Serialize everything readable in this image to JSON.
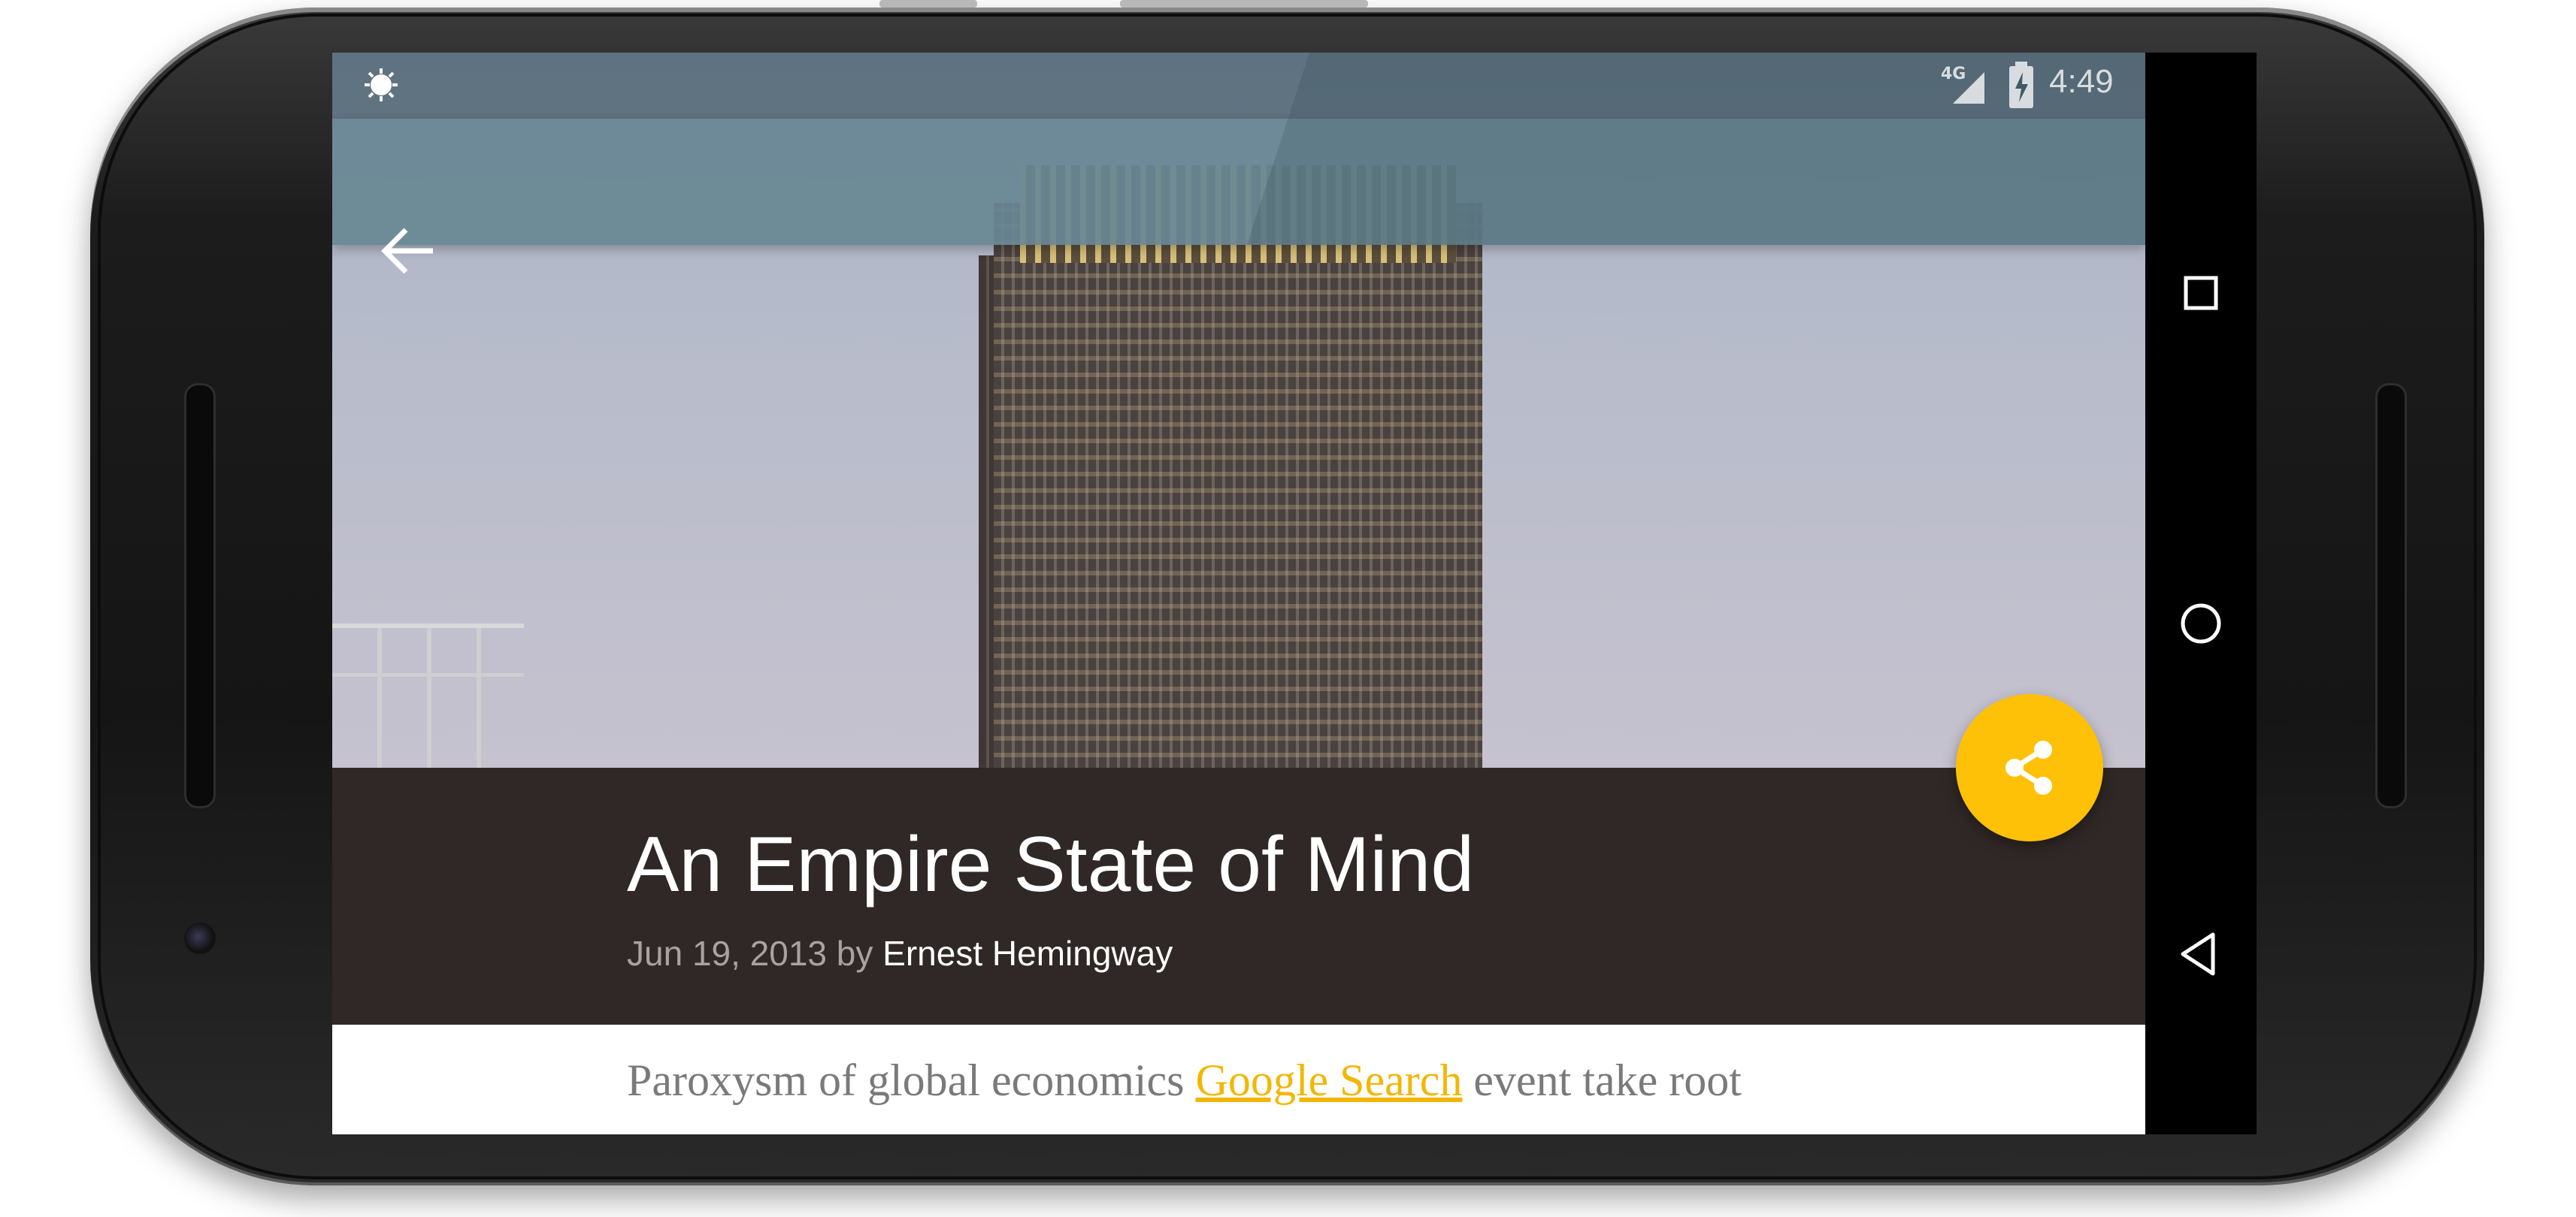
{
  "status_bar": {
    "network_type": "4G",
    "time": "4:49"
  },
  "toolbar": {
    "back_icon": "arrow-back-icon"
  },
  "article": {
    "title": "An Empire State of Mind",
    "date": "Jun 19, 2013",
    "by_word": " by ",
    "author": "Ernest Hemingway",
    "body_before_link": "Paroxysm of global economics ",
    "body_link": "Google Search",
    "body_after_link": " event take root"
  },
  "fab": {
    "icon": "share-icon",
    "color": "#ffc107"
  },
  "nav_bar": {
    "icons": [
      "recents-square-icon",
      "home-circle-icon",
      "back-triangle-icon"
    ]
  },
  "colors": {
    "accent": "#ffc107",
    "title_background": "#302827",
    "toolbar": "#688794"
  }
}
